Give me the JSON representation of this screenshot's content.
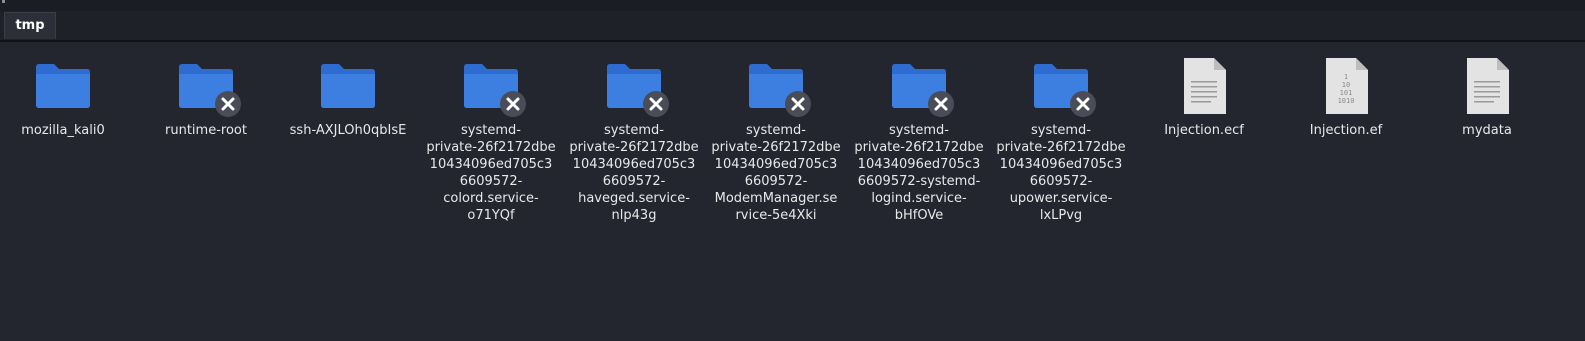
{
  "tab": {
    "label": "tmp"
  },
  "colors": {
    "folder": "#3d7fe0",
    "folder_tab": "#2f6cd1",
    "background": "#23262f"
  },
  "items": [
    {
      "name": "mozilla_kali0",
      "type": "folder",
      "emblem": "none"
    },
    {
      "name": "runtime-root",
      "type": "folder",
      "emblem": "unreadable-icon"
    },
    {
      "name": "ssh-AXJLOh0qbIsE",
      "type": "folder",
      "emblem": "none"
    },
    {
      "name": "systemd-\nprivate-26f2172dbe\n10434096ed705c3\n6609572-\ncolord.service-\no71YQf",
      "type": "folder",
      "emblem": "unreadable-icon"
    },
    {
      "name": "systemd-\nprivate-26f2172dbe\n10434096ed705c3\n6609572-\nhaveged.service-\nnlp43g",
      "type": "folder",
      "emblem": "unreadable-icon"
    },
    {
      "name": "systemd-\nprivate-26f2172dbe\n10434096ed705c3\n6609572-\nModemManager.se\nrvice-5e4Xki",
      "type": "folder",
      "emblem": "unreadable-icon"
    },
    {
      "name": "systemd-\nprivate-26f2172dbe\n10434096ed705c3\n6609572-systemd-\nlogind.service-\nbHfOVe",
      "type": "folder",
      "emblem": "unreadable-icon"
    },
    {
      "name": "systemd-\nprivate-26f2172dbe\n10434096ed705c3\n6609572-\nupower.service-\nlxLPvg",
      "type": "folder",
      "emblem": "unreadable-icon"
    },
    {
      "name": "Injection.ecf",
      "type": "text-file",
      "emblem": "none"
    },
    {
      "name": "Injection.ef",
      "type": "binary-file",
      "emblem": "none"
    },
    {
      "name": "mydata",
      "type": "text-file",
      "emblem": "none"
    }
  ]
}
